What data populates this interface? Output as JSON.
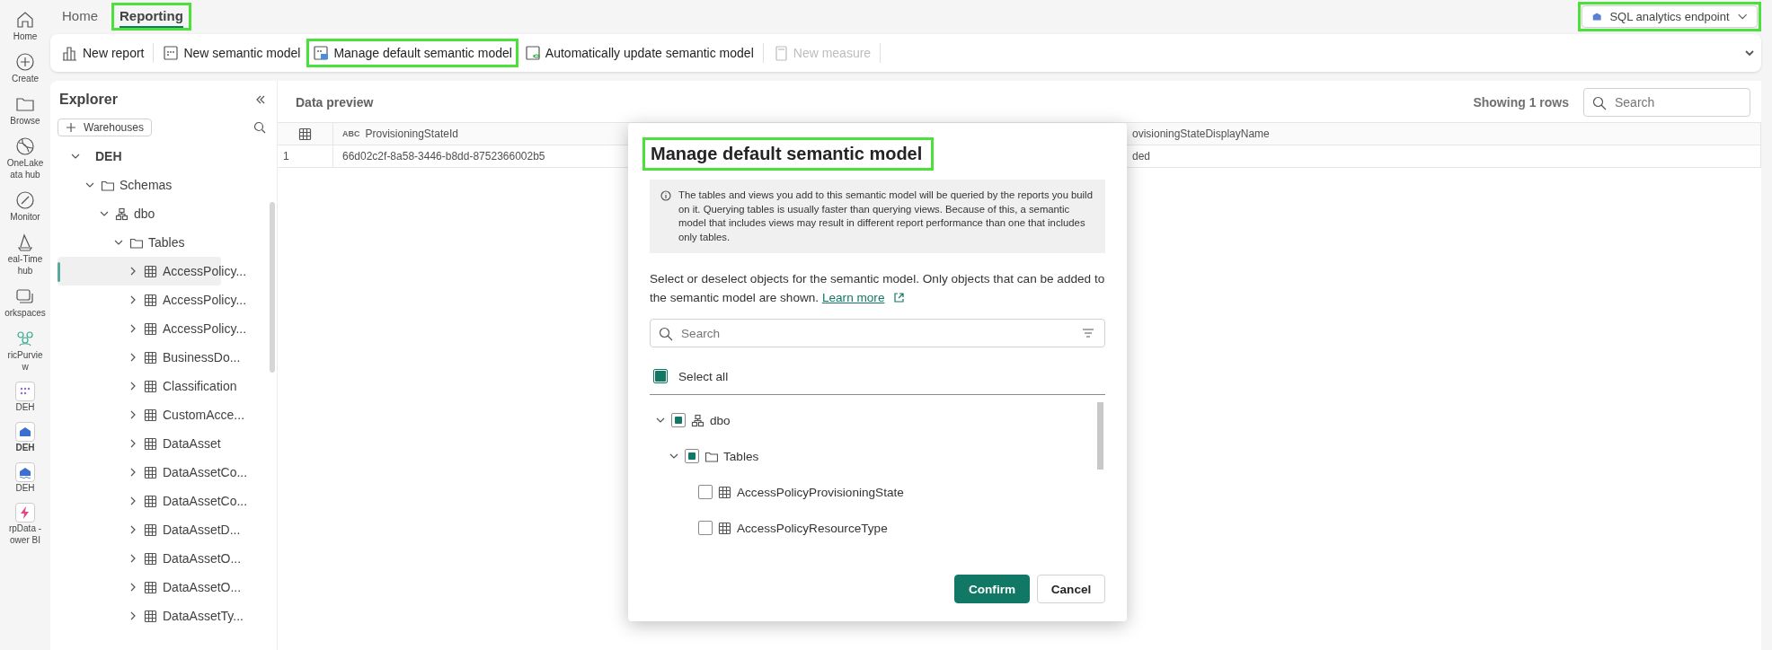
{
  "rail": [
    {
      "lines": [
        "Home"
      ],
      "selected": false
    },
    {
      "lines": [
        "Create"
      ],
      "selected": false
    },
    {
      "lines": [
        "Browse"
      ],
      "selected": false
    },
    {
      "lines": [
        "OneLake",
        "ata hub"
      ],
      "selected": false
    },
    {
      "lines": [
        "Monitor"
      ],
      "selected": false
    },
    {
      "lines": [
        "eal-Time",
        "hub"
      ],
      "selected": false
    },
    {
      "lines": [
        "orkspaces"
      ],
      "selected": false
    },
    {
      "lines": [
        "ricPurvie",
        "w"
      ],
      "selected": false
    },
    {
      "lines": [
        "DEH"
      ],
      "selected": false
    },
    {
      "lines": [
        "DEH"
      ],
      "selected": true
    },
    {
      "lines": [
        "DEH"
      ],
      "selected": false
    },
    {
      "lines": [
        "rpData -",
        "ower BI"
      ],
      "selected": false
    }
  ],
  "tabs": [
    {
      "label": "Home",
      "selected": false,
      "highlighted": false
    },
    {
      "label": "Reporting",
      "selected": true,
      "highlighted": true
    }
  ],
  "endpoint_dropdown": {
    "label": "SQL analytics endpoint",
    "highlighted": true
  },
  "toolbar": [
    {
      "label": "New report",
      "disabled": false,
      "highlighted": false
    },
    {
      "label": "New semantic model",
      "disabled": false,
      "highlighted": false
    },
    {
      "label": "Manage default semantic model",
      "disabled": false,
      "highlighted": true
    },
    {
      "label": "Automatically update semantic model",
      "disabled": false,
      "highlighted": false
    },
    {
      "label": "New measure",
      "disabled": true,
      "highlighted": false
    }
  ],
  "explorer": {
    "title": "Explorer",
    "add_button": "Warehouses",
    "tree": [
      {
        "label": "DEH",
        "expanded": true,
        "kind": "root",
        "children": [
          {
            "label": "Schemas",
            "expanded": true,
            "kind": "folder",
            "children": [
              {
                "label": "dbo",
                "expanded": true,
                "kind": "schema",
                "children": [
                  {
                    "label": "Tables",
                    "expanded": true,
                    "kind": "folder",
                    "children": [
                      {
                        "label": "AccessPolicy...",
                        "expanded": false,
                        "kind": "table",
                        "selected": true
                      },
                      {
                        "label": "AccessPolicy...",
                        "expanded": false,
                        "kind": "table",
                        "selected": false
                      },
                      {
                        "label": "AccessPolicy...",
                        "expanded": false,
                        "kind": "table",
                        "selected": false
                      },
                      {
                        "label": "BusinessDo...",
                        "expanded": false,
                        "kind": "table",
                        "selected": false
                      },
                      {
                        "label": "Classification",
                        "expanded": false,
                        "kind": "table",
                        "selected": false
                      },
                      {
                        "label": "CustomAcce...",
                        "expanded": false,
                        "kind": "table",
                        "selected": false
                      },
                      {
                        "label": "DataAsset",
                        "expanded": false,
                        "kind": "table",
                        "selected": false
                      },
                      {
                        "label": "DataAssetCo...",
                        "expanded": false,
                        "kind": "table",
                        "selected": false
                      },
                      {
                        "label": "DataAssetCo...",
                        "expanded": false,
                        "kind": "table",
                        "selected": false
                      },
                      {
                        "label": "DataAssetD...",
                        "expanded": false,
                        "kind": "table",
                        "selected": false
                      },
                      {
                        "label": "DataAssetO...",
                        "expanded": false,
                        "kind": "table",
                        "selected": false
                      },
                      {
                        "label": "DataAssetO...",
                        "expanded": false,
                        "kind": "table",
                        "selected": false
                      },
                      {
                        "label": "DataAssetTy...",
                        "expanded": false,
                        "kind": "table",
                        "selected": false
                      }
                    ]
                  }
                ]
              }
            ]
          }
        ]
      }
    ]
  },
  "preview": {
    "title": "Data preview",
    "row_count": "Showing 1 rows",
    "search": {
      "placeholder": "Search"
    },
    "table": {
      "columns": [
        {
          "type": "ABC",
          "label": "ProvisioningStateId"
        },
        {
          "label": "ovisioningStateDisplayName"
        }
      ],
      "rows": [
        {
          "number": "1",
          "cells": [
            "66d02c2f-8a58-3446-b8dd-8752366002b5",
            "ded"
          ]
        }
      ]
    }
  },
  "dialog": {
    "title": "Manage default semantic model",
    "highlighted": true,
    "info": "The tables and views you add to this semantic model will be queried by the reports you build on it. Querying tables is usually faster than querying views. Because of this, a semantic model that includes views may result in different report performance than one that includes only tables.",
    "description": "Select or deselect objects for the semantic model. Only objects that can be added to the semantic model are shown.",
    "link": "Learn more",
    "search": {
      "placeholder": "Search"
    },
    "select_all": {
      "label": "Select all",
      "checked": false,
      "indeterminate": true
    },
    "tree": [
      {
        "label": "dbo",
        "kind": "schema",
        "expanded": true,
        "checked": false,
        "indeterminate": true,
        "children": [
          {
            "label": "Tables",
            "kind": "folder",
            "expanded": true,
            "checked": false,
            "indeterminate": true,
            "children": [
              {
                "label": "AccessPolicyProvisioningState",
                "kind": "table",
                "checked": false,
                "indeterminate": false
              },
              {
                "label": "AccessPolicyResourceType",
                "kind": "table",
                "checked": false,
                "indeterminate": false
              }
            ]
          }
        ]
      }
    ],
    "buttons": [
      {
        "label": "Confirm",
        "kind": "primary"
      },
      {
        "label": "Cancel",
        "kind": "secondary"
      }
    ]
  }
}
